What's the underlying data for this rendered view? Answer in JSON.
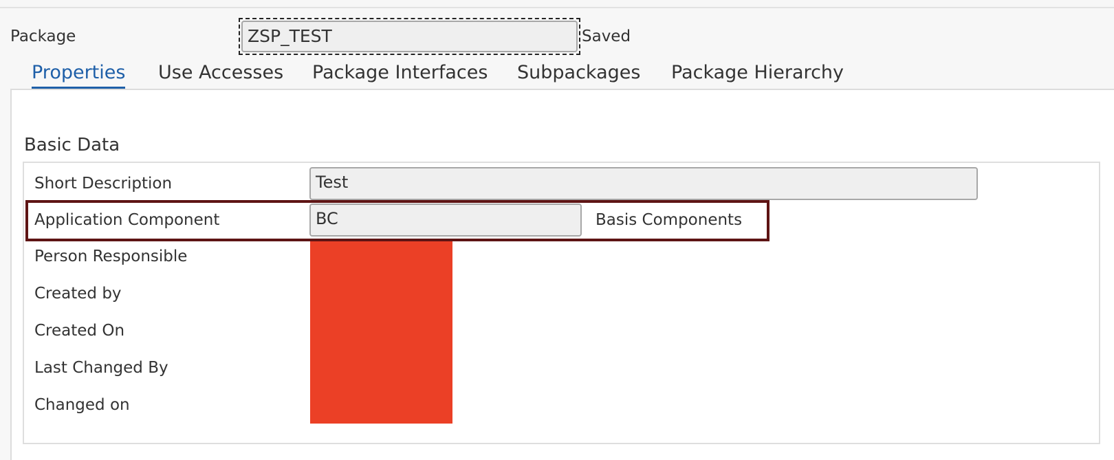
{
  "header": {
    "package_label": "Package",
    "package_value": "ZSP_TEST",
    "status": "Saved"
  },
  "tabs": [
    {
      "label": "Properties",
      "active": true
    },
    {
      "label": "Use Accesses",
      "active": false
    },
    {
      "label": "Package Interfaces",
      "active": false
    },
    {
      "label": "Subpackages",
      "active": false
    },
    {
      "label": "Package Hierarchy",
      "active": false
    }
  ],
  "basic_data": {
    "title": "Basic Data",
    "short_description_label": "Short Description",
    "short_description_value": "Test",
    "application_component_label": "Application Component",
    "application_component_value": "BC",
    "application_component_description": "Basis Components",
    "person_responsible_label": "Person Responsible",
    "created_by_label": "Created by",
    "created_on_label": "Created On",
    "last_changed_by_label": "Last Changed By",
    "changed_on_label": "Changed on"
  },
  "colors": {
    "accent": "#1e5fa8",
    "highlight_border": "#5e1414",
    "redaction": "#eb4026"
  }
}
